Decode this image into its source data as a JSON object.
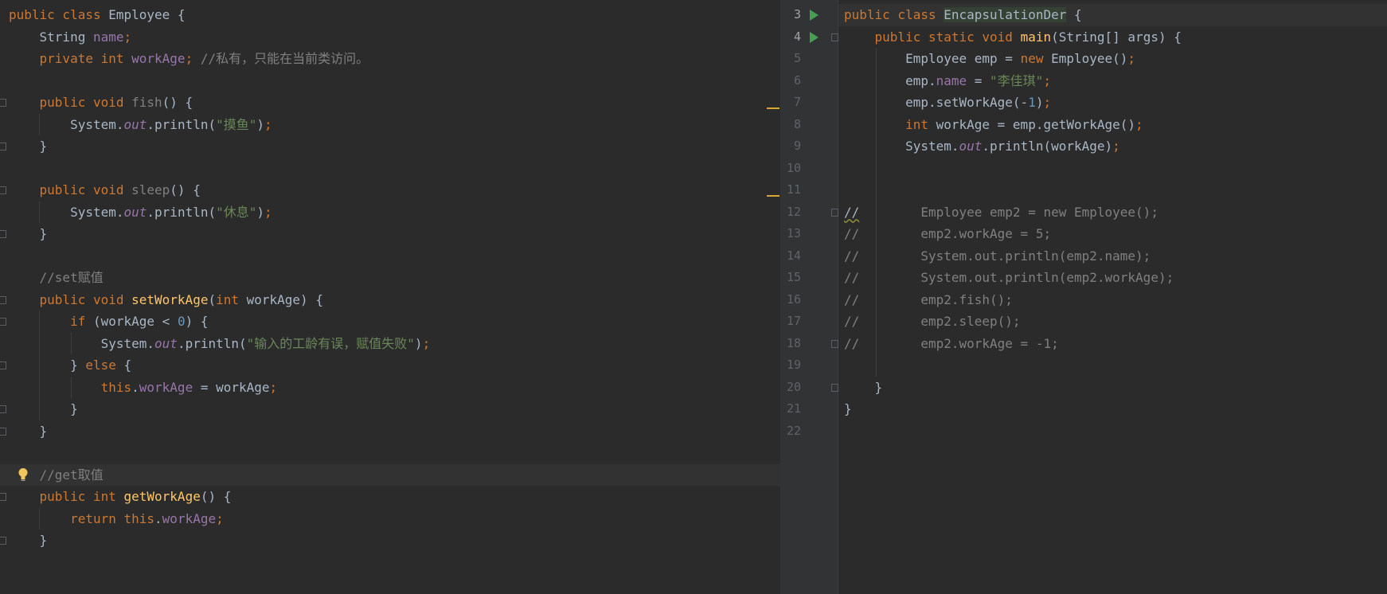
{
  "left_editor": {
    "lines": [
      [
        [
          "kw",
          "public class "
        ],
        [
          "txt",
          "Employee {"
        ]
      ],
      [
        [
          "txt",
          "    String "
        ],
        [
          "fld",
          "name"
        ],
        [
          "kw",
          ";"
        ]
      ],
      [
        [
          "kw",
          "    private int "
        ],
        [
          "fld",
          "workAge"
        ],
        [
          "kw",
          "; "
        ],
        [
          "cm",
          "//私有，只能在当前类访问。"
        ]
      ],
      [],
      [
        [
          "kw",
          "    public void "
        ],
        [
          "dim",
          "fish"
        ],
        [
          "txt",
          "() {"
        ]
      ],
      [
        [
          "txt",
          "        System."
        ],
        [
          "st",
          "out"
        ],
        [
          "txt",
          ".println("
        ],
        [
          "str",
          "\"摸鱼\""
        ],
        [
          "txt",
          ")"
        ],
        [
          "kw",
          ";"
        ]
      ],
      [
        [
          "txt",
          "    }"
        ]
      ],
      [],
      [
        [
          "kw",
          "    public void "
        ],
        [
          "dim",
          "sleep"
        ],
        [
          "txt",
          "() {"
        ]
      ],
      [
        [
          "txt",
          "        System."
        ],
        [
          "st",
          "out"
        ],
        [
          "txt",
          ".println("
        ],
        [
          "str",
          "\"休息\""
        ],
        [
          "txt",
          ")"
        ],
        [
          "kw",
          ";"
        ]
      ],
      [
        [
          "txt",
          "    }"
        ]
      ],
      [],
      [
        [
          "cm",
          "    //set赋值"
        ]
      ],
      [
        [
          "kw",
          "    public void "
        ],
        [
          "fn",
          "setWorkAge"
        ],
        [
          "txt",
          "("
        ],
        [
          "kw",
          "int "
        ],
        [
          "txt",
          "workAge) {"
        ]
      ],
      [
        [
          "kw",
          "        if "
        ],
        [
          "txt",
          "(workAge < "
        ],
        [
          "num",
          "0"
        ],
        [
          "txt",
          ") {"
        ]
      ],
      [
        [
          "txt",
          "            System."
        ],
        [
          "st",
          "out"
        ],
        [
          "txt",
          ".println("
        ],
        [
          "str",
          "\"输入的工龄有误，赋值失败\""
        ],
        [
          "txt",
          ")"
        ],
        [
          "kw",
          ";"
        ]
      ],
      [
        [
          "txt",
          "        } "
        ],
        [
          "kw",
          "else "
        ],
        [
          "txt",
          "{"
        ]
      ],
      [
        [
          "kw",
          "            this"
        ],
        [
          "txt",
          "."
        ],
        [
          "fld",
          "workAge"
        ],
        [
          "txt",
          " = workAge"
        ],
        [
          "kw",
          ";"
        ]
      ],
      [
        [
          "txt",
          "        }"
        ]
      ],
      [
        [
          "txt",
          "    }"
        ]
      ],
      [],
      [
        [
          "cm",
          "    //get取值"
        ]
      ],
      [
        [
          "kw",
          "    public int "
        ],
        [
          "fn",
          "getWorkAge"
        ],
        [
          "txt",
          "() {"
        ]
      ],
      [
        [
          "kw",
          "        return this"
        ],
        [
          "txt",
          "."
        ],
        [
          "fld",
          "workAge"
        ],
        [
          "kw",
          ";"
        ]
      ],
      [
        [
          "txt",
          "    }"
        ]
      ]
    ]
  },
  "right_editor": {
    "line_numbers": [
      "3",
      "4",
      "5",
      "6",
      "7",
      "8",
      "9",
      "10",
      "11",
      "12",
      "13",
      "14",
      "15",
      "16",
      "17",
      "18",
      "19",
      "20",
      "21",
      "22"
    ],
    "lines": [
      [
        [
          "kw",
          "public class "
        ],
        [
          "cls",
          "EncapsulationDer"
        ],
        [
          "txt",
          " {"
        ]
      ],
      [
        [
          "kw",
          "    public static void "
        ],
        [
          "fn",
          "main"
        ],
        [
          "txt",
          "(String[] args) {"
        ]
      ],
      [
        [
          "txt",
          "        Employee emp = "
        ],
        [
          "kw",
          "new "
        ],
        [
          "txt",
          "Employee()"
        ],
        [
          "kw",
          ";"
        ]
      ],
      [
        [
          "txt",
          "        emp."
        ],
        [
          "fld",
          "name"
        ],
        [
          "txt",
          " = "
        ],
        [
          "str",
          "\"李佳琪\""
        ],
        [
          "kw",
          ";"
        ]
      ],
      [
        [
          "txt",
          "        emp.setWorkAge(-"
        ],
        [
          "num",
          "1"
        ],
        [
          "txt",
          ")"
        ],
        [
          "kw",
          ";"
        ]
      ],
      [
        [
          "kw",
          "        int "
        ],
        [
          "txt",
          "workAge = emp.getWorkAge()"
        ],
        [
          "kw",
          ";"
        ]
      ],
      [
        [
          "txt",
          "        System."
        ],
        [
          "st",
          "out"
        ],
        [
          "txt",
          ".println(workAge)"
        ],
        [
          "kw",
          ";"
        ]
      ],
      [],
      [],
      [
        [
          "sq",
          "//"
        ],
        [
          "cm",
          "        Employee emp2 = new Employee();"
        ]
      ],
      [
        [
          "cm",
          "//        emp2.workAge = 5;"
        ]
      ],
      [
        [
          "cm",
          "//        System.out.println(emp2.name);"
        ]
      ],
      [
        [
          "cm",
          "//        System.out.println(emp2.workAge);"
        ]
      ],
      [
        [
          "cm",
          "//        emp2.fish();"
        ]
      ],
      [
        [
          "cm",
          "//        emp2.sleep();"
        ]
      ],
      [
        [
          "cm",
          "//        emp2.workAge = -1;"
        ]
      ],
      [],
      [
        [
          "txt",
          "    }"
        ]
      ],
      [
        [
          "txt",
          "}"
        ]
      ],
      []
    ]
  }
}
